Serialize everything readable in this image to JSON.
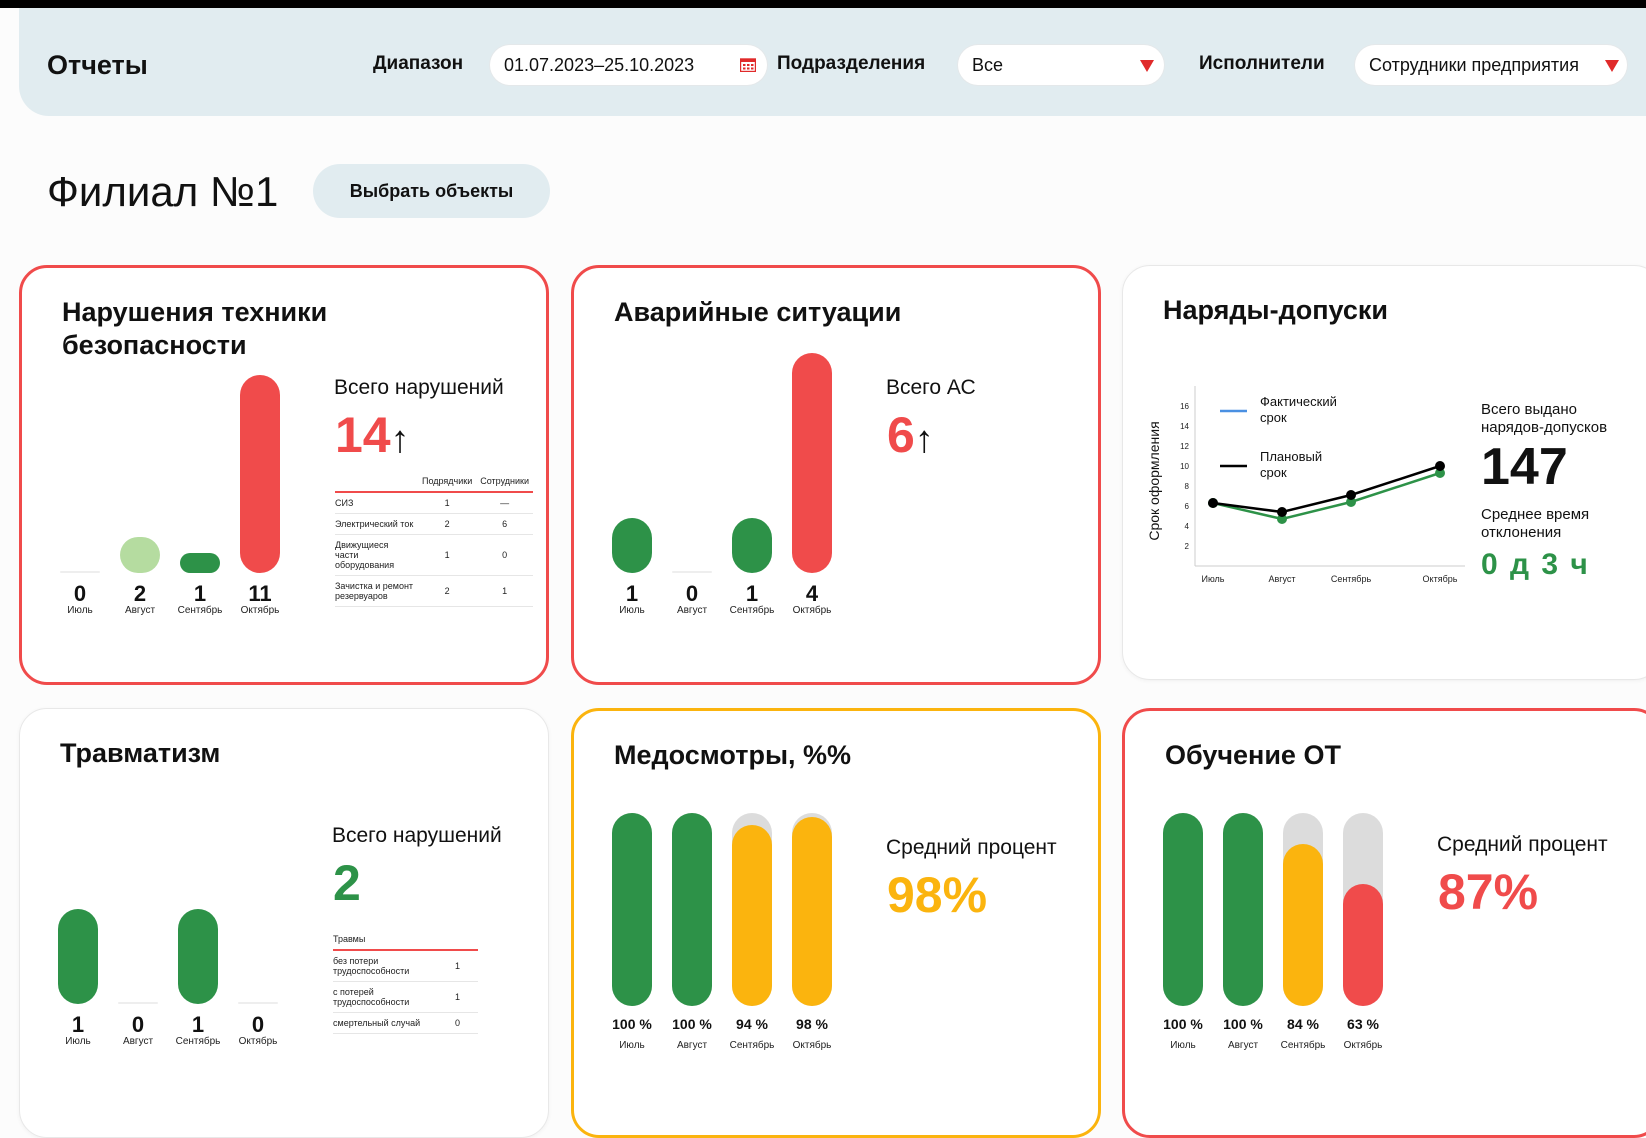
{
  "header": {
    "title": "Отчеты",
    "range_label": "Диапазон",
    "range_value": "01.07.2023–25.10.2023",
    "division_label": "Подразделения",
    "division_value": "Все",
    "executors_label": "Исполнители",
    "executors_value": "Сотрудники предприятия"
  },
  "branch": {
    "title": "Филиал №1",
    "select_button": "Выбрать объекты"
  },
  "colors": {
    "red": "#f04b4b",
    "green": "#2d9248",
    "light_green": "#b5dca0",
    "yellow": "#fbb40e",
    "gray": "#dcdcdc",
    "blue": "#4a90e2"
  },
  "cards": {
    "violations": {
      "title": "Нарушения техники безопасности",
      "stat_label": "Всего нарушений",
      "total": "14",
      "arrow": "↑",
      "months": [
        "Июль",
        "Август",
        "Сентябрь",
        "Октябрь"
      ],
      "values": [
        0,
        2,
        1,
        11
      ],
      "table": {
        "headers": [
          "Подрядчики",
          "Сотрудники"
        ],
        "rows": [
          {
            "label": "СИЗ",
            "a": "1",
            "b": "—"
          },
          {
            "label": "Электрический ток",
            "a": "2",
            "b": "6"
          },
          {
            "label": "Движущиеся части оборудования",
            "a": "1",
            "b": "0"
          },
          {
            "label": "Зачистка и ремонт резервуаров",
            "a": "2",
            "b": "1"
          }
        ]
      }
    },
    "emergencies": {
      "title": "Аварийные ситуации",
      "stat_label": "Всего АС",
      "total": "6",
      "arrow": "↑",
      "months": [
        "Июль",
        "Август",
        "Сентябрь",
        "Октябрь"
      ],
      "values": [
        1,
        0,
        1,
        4
      ]
    },
    "permits": {
      "title": "Наряды-допуски",
      "stat_label": "Всего выдано нарядов-допусков",
      "total": "147",
      "deviation_label": "Среднее время отклонения",
      "deviation_value": "0 д 3 ч",
      "chart_data": {
        "type": "line",
        "ylabel": "Срок оформления",
        "x": [
          "Июль",
          "Август",
          "Сентябрь",
          "Октябрь"
        ],
        "yticks": [
          2,
          4,
          6,
          8,
          10,
          12,
          14,
          16
        ],
        "ylim": [
          0,
          18
        ],
        "series": [
          {
            "name": "Фактический срок",
            "values": [
              6.3,
              4.7,
              6.4,
              9.3
            ]
          },
          {
            "name": "Плановый срок",
            "values": [
              6.3,
              5.4,
              7.1,
              10.0
            ]
          }
        ]
      }
    },
    "injuries": {
      "title": "Травматизм",
      "stat_label": "Всего нарушений",
      "total": "2",
      "months": [
        "Июль",
        "Август",
        "Сентябрь",
        "Октябрь"
      ],
      "values": [
        1,
        0,
        1,
        0
      ],
      "table": {
        "header": "Травмы",
        "rows": [
          {
            "label": "без потери трудоспособности",
            "value": "1"
          },
          {
            "label": "с потерей трудоспособности",
            "value": "1"
          },
          {
            "label": "смертельный случай",
            "value": "0"
          }
        ]
      }
    },
    "medical": {
      "title": "Медосмотры, %%",
      "stat_label": "Средний процент",
      "average": "98%",
      "months": [
        "Июль",
        "Август",
        "Сентябрь",
        "Октябрь"
      ],
      "values": [
        100,
        100,
        94,
        98
      ],
      "value_labels": [
        "100 %",
        "100 %",
        "94 %",
        "98 %"
      ]
    },
    "training": {
      "title": "Обучение ОТ",
      "stat_label": "Средний процент",
      "average": "87%",
      "months": [
        "Июль",
        "Август",
        "Сентябрь",
        "Октябрь"
      ],
      "values": [
        100,
        100,
        84,
        63
      ],
      "value_labels": [
        "100 %",
        "100 %",
        "84 %",
        "63 %"
      ]
    }
  }
}
